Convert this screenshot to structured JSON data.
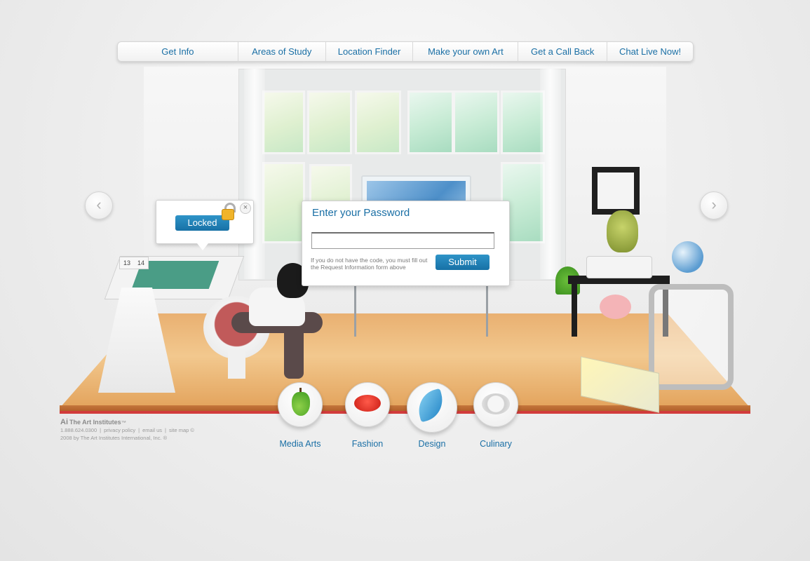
{
  "nav": {
    "items": [
      {
        "label": "Get Info"
      },
      {
        "label": "Areas of Study"
      },
      {
        "label": "Location Finder"
      },
      {
        "label": "Make your own Art"
      },
      {
        "label": "Get a Call Back"
      },
      {
        "label": "Chat Live Now!"
      }
    ]
  },
  "carousel": {
    "prev_glyph": "‹",
    "next_glyph": "›"
  },
  "desk_calendar": {
    "pages": [
      "13",
      "14"
    ]
  },
  "lock_popup": {
    "button_label": "Locked",
    "close_glyph": "×",
    "icon": "padlock-open-icon"
  },
  "password_popup": {
    "title": "Enter your Password",
    "input_value": "",
    "help_text": "If you do not have the code, you must fill out the Request Information form above",
    "submit_label": "Submit"
  },
  "categories": [
    {
      "label": "Media Arts",
      "icon": "pear-icon"
    },
    {
      "label": "Fashion",
      "icon": "bottle-cap-icon"
    },
    {
      "label": "Design",
      "icon": "feather-icon"
    },
    {
      "label": "Culinary",
      "icon": "plate-icon"
    }
  ],
  "footer": {
    "brand": "The Art Institutes",
    "logo_mark": "Ai",
    "trademark": "™",
    "phone": "1.888.624.0300",
    "privacy": "privacy policy",
    "email": "email us",
    "sitemap": "site map ©",
    "copyright": "2008 by The Art Institutes International, Inc. ®"
  },
  "colors": {
    "link_blue": "#1a6fa5",
    "button_blue": "#1f82b8",
    "background": "#e9e9e9"
  }
}
